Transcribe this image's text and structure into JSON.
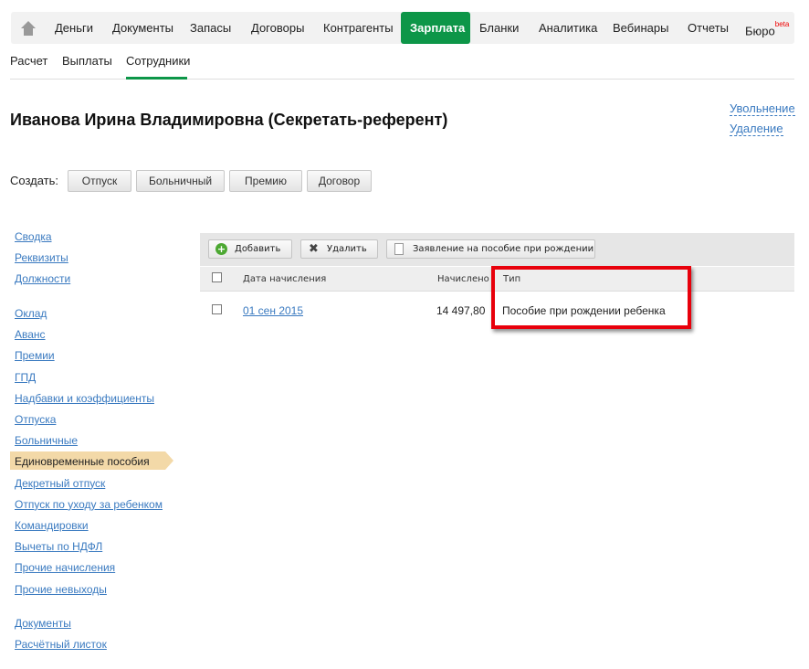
{
  "nav": {
    "items": [
      "Деньги",
      "Документы",
      "Запасы",
      "Договоры",
      "Контрагенты",
      "Зарплата",
      "Бланки",
      "Аналитика",
      "Вебинары",
      "Отчеты",
      "Бюро"
    ],
    "active": "Зарплата",
    "beta": "beta"
  },
  "subnav": [
    "Расчет",
    "Выплаты",
    "Сотрудники"
  ],
  "title": "Иванова Ирина Владимировна (Секретать-референт)",
  "right_links": [
    "Увольнение",
    "Удаление"
  ],
  "create": {
    "label": "Создать:",
    "buttons": [
      "Отпуск",
      "Больничный",
      "Премию",
      "Договор"
    ]
  },
  "sidebar": {
    "group1": [
      "Сводка",
      "Реквизиты",
      "Должности"
    ],
    "group2": [
      "Оклад",
      "Аванс",
      "Премии",
      "ГПД",
      "Надбавки и коэффициенты",
      "Отпуска",
      "Больничные",
      "Единовременные пособия",
      "Декретный отпуск",
      "Отпуск по уходу за ребенком",
      "Командировки",
      "Вычеты по НДФЛ",
      "Прочие начисления",
      "Прочие невыходы"
    ],
    "group3": [
      "Документы",
      "Расчётный листок"
    ],
    "active": "Единовременные пособия"
  },
  "toolbar": {
    "add": "Добавить",
    "delete": "Удалить",
    "statement": "Заявление на пособие при рождении"
  },
  "table": {
    "headers": [
      "Дата начисления",
      "Начислено",
      "Тип"
    ],
    "rows": [
      {
        "date": "01 сен 2015",
        "amount": "14 497,80",
        "type": "Пособие при рождении ребенка"
      }
    ]
  },
  "colors": {
    "accent": "#0d9648",
    "link": "#3a7ac0",
    "highlight": "#e8000b"
  }
}
